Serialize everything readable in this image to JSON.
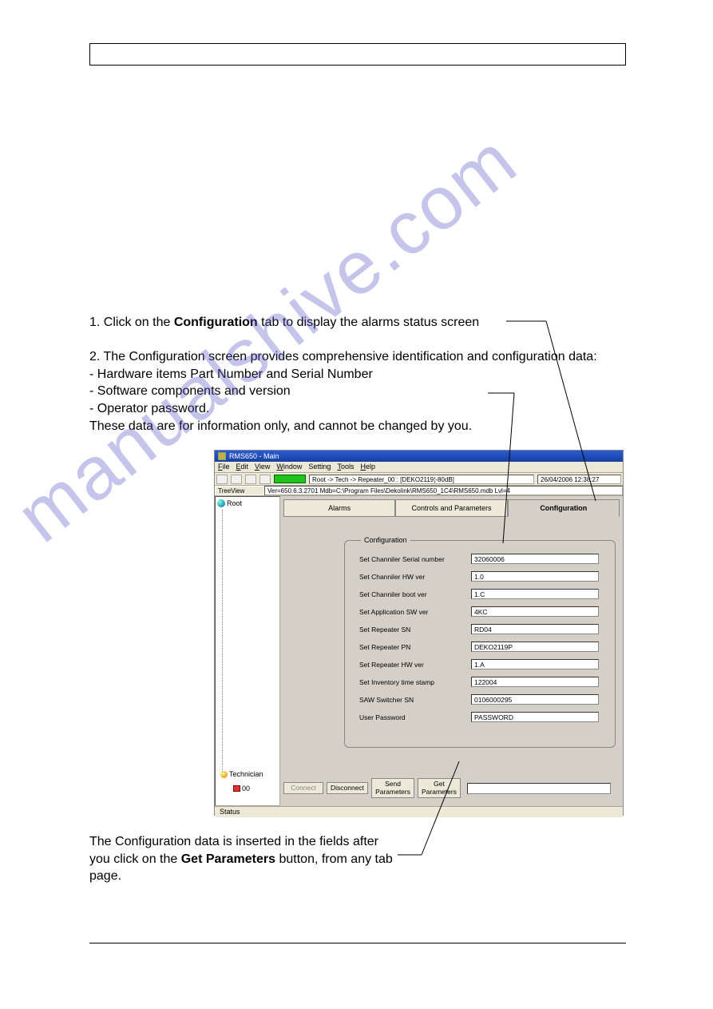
{
  "instructions": {
    "step1_pre": "1. Click on the ",
    "step1_bold": "Configuration",
    "step1_post": " tab to display the alarms status screen",
    "step2_intro": "2. The Configuration screen provides comprehensive identification and configuration data:",
    "bullet1": "-  Hardware items Part Number and Serial Number",
    "bullet2": "-  Software components and version",
    "bullet3": "-  Operator password.",
    "step2_outro": "These data are for information only, and cannot be changed by you."
  },
  "footer": {
    "line1": "The Configuration data is inserted in the fields after",
    "line2_pre": "you click on the ",
    "line2_bold": "Get Parameters",
    "line2_post": " button, from any tab",
    "line3": "page."
  },
  "app": {
    "title": "RMS650 - Main",
    "menu": {
      "file": "File",
      "edit": "Edit",
      "view": "View",
      "window": "Window",
      "setting": "Setting",
      "tools": "Tools",
      "help": "Help"
    },
    "toolbar": {
      "path": "Root -> Tech -> Repeater_00 : [DEKO2119¦-80dB]",
      "date": "26/04/2006 12:38:27"
    },
    "infobar": {
      "label": "TreeView",
      "value": "Ver=650.6.3.2701  Mdb=C:\\Program Files\\Dekolink\\RMS650_1C4\\RMS650.mdb  Lvl=4"
    },
    "tree": {
      "root": "Root",
      "tech": "Technician",
      "leaf": "00"
    },
    "tabs": {
      "alarms": "Alarms",
      "controls": "Controls and Parameters",
      "config": "Configuration"
    },
    "group_legend": "Configuration",
    "fields": [
      {
        "label": "Set Channiler Serial number",
        "value": "32060006"
      },
      {
        "label": "Set Channiler HW ver",
        "value": "1.0"
      },
      {
        "label": "Set Channiler boot ver",
        "value": "1.C"
      },
      {
        "label": "Set Application SW ver",
        "value": "4KC"
      },
      {
        "label": "Set Repeater SN",
        "value": "RD04"
      },
      {
        "label": "Set Repeater PN",
        "value": "DEKO2119P"
      },
      {
        "label": "Set Repeater HW ver",
        "value": "1.A"
      },
      {
        "label": "Set Inventory time stamp",
        "value": "122004"
      },
      {
        "label": "SAW Switcher SN",
        "value": "0106000295"
      },
      {
        "label": "User Password",
        "value": "PASSWORD"
      }
    ],
    "buttons": {
      "connect": "Connect",
      "disconnect": "Disconnect",
      "send": "Send\nParameters",
      "get": "Get\nParameters"
    },
    "status": "Status"
  },
  "watermark": "manualshive.com"
}
